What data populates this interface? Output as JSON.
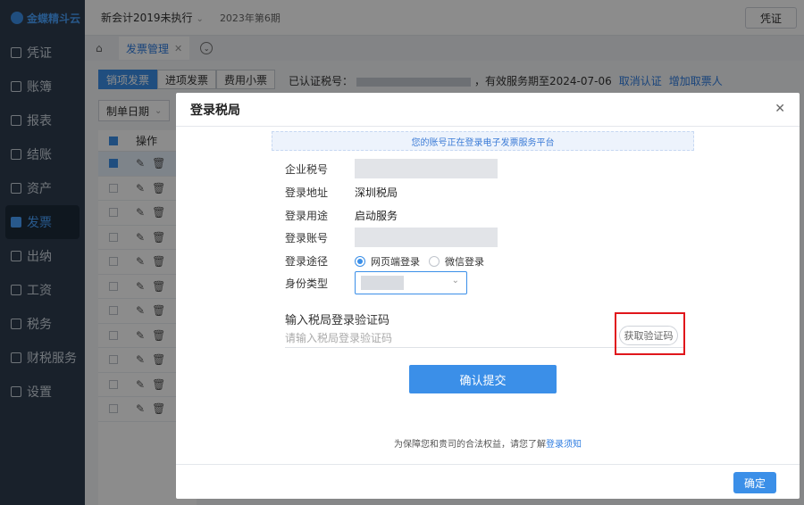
{
  "logo": {
    "text": "金蝶精斗云"
  },
  "sidebar": {
    "items": [
      {
        "label": "凭证",
        "icon": "voucher-icon"
      },
      {
        "label": "账簿",
        "icon": "ledger-icon"
      },
      {
        "label": "报表",
        "icon": "report-icon"
      },
      {
        "label": "结账",
        "icon": "closing-icon"
      },
      {
        "label": "资产",
        "icon": "asset-icon"
      },
      {
        "label": "发票",
        "icon": "invoice-icon",
        "active": true
      },
      {
        "label": "出纳",
        "icon": "cashier-icon"
      },
      {
        "label": "工资",
        "icon": "salary-icon"
      },
      {
        "label": "税务",
        "icon": "tax-icon"
      },
      {
        "label": "财税服务",
        "icon": "finance-service-icon"
      },
      {
        "label": "设置",
        "icon": "settings-icon"
      }
    ]
  },
  "topbar": {
    "account": "新会计2019未执行",
    "period": "2023年第6期",
    "voucher_button": "凭证"
  },
  "tabs": {
    "page_tab": "发票管理"
  },
  "content": {
    "subtabs": [
      "销项发票",
      "进项发票",
      "费用小票"
    ],
    "tax_prefix": "已认证税号：",
    "tax_suffix": "，有效服务期至2024-07-06",
    "cancel_auth": "取消认证",
    "add_ticket_taker": "增加取票人",
    "filter_label": "制单日期",
    "table_header": "操作",
    "row_count": 11
  },
  "modal": {
    "title": "登录税局",
    "banner": "您的账号正在登录电子发票服务平台",
    "fields": {
      "company_tax_label": "企业税号",
      "address_label": "登录地址",
      "address_value": "深圳税局",
      "purpose_label": "登录用途",
      "purpose_value": "启动服务",
      "account_label": "登录账号",
      "method_label": "登录途径",
      "method_web": "网页端登录",
      "method_wechat": "微信登录",
      "identity_label": "身份类型"
    },
    "code_title": "输入税局登录验证码",
    "code_placeholder": "请输入税局登录验证码",
    "get_code_button": "获取验证码",
    "submit_button": "确认提交",
    "notice_prefix": "为保障您和贵司的合法权益，请您了解",
    "notice_link": "登录须知",
    "ok_button": "确定"
  },
  "colors": {
    "primary": "#3b8fe8",
    "sidebar_bg": "#2f3d4f",
    "highlight": "#e0161b"
  }
}
